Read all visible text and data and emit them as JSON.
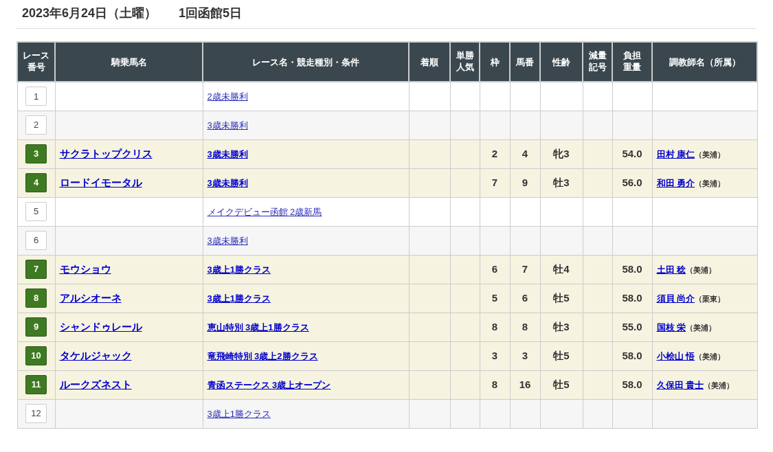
{
  "title": {
    "date": "2023年6月24日（土曜）",
    "meeting": "1回函館5日"
  },
  "table": {
    "columns": [
      "レース番号",
      "騎乗馬名",
      "レース名・競走種別・条件",
      "着順",
      "単勝人気",
      "枠",
      "馬番",
      "性齢",
      "減量記号",
      "負担重量",
      "調教師名（所属）"
    ],
    "rows": [
      {
        "race": "1",
        "ridden": false,
        "race_name": "2歳未勝利"
      },
      {
        "race": "2",
        "ridden": false,
        "race_name": "3歳未勝利"
      },
      {
        "race": "3",
        "ridden": true,
        "horse": "サクラトップクリス",
        "race_name": "3歳未勝利",
        "frame": "2",
        "number": "4",
        "sex_age": "牝3",
        "weight": "54.0",
        "trainer": "田村 康仁",
        "affiliation": "（美浦）"
      },
      {
        "race": "4",
        "ridden": true,
        "horse": "ロードイモータル",
        "race_name": "3歳未勝利",
        "frame": "7",
        "number": "9",
        "sex_age": "牡3",
        "weight": "56.0",
        "trainer": "和田 勇介",
        "affiliation": "（美浦）"
      },
      {
        "race": "5",
        "ridden": false,
        "race_name": "メイクデビュー函館 2歳新馬"
      },
      {
        "race": "6",
        "ridden": false,
        "race_name": "3歳未勝利"
      },
      {
        "race": "7",
        "ridden": true,
        "horse": "モウショウ",
        "race_name": "3歳上1勝クラス",
        "frame": "6",
        "number": "7",
        "sex_age": "牡4",
        "weight": "58.0",
        "trainer": "土田 稔",
        "affiliation": "（美浦）"
      },
      {
        "race": "8",
        "ridden": true,
        "horse": "アルシオーネ",
        "race_name": "3歳上1勝クラス",
        "frame": "5",
        "number": "6",
        "sex_age": "牡5",
        "weight": "58.0",
        "trainer": "須貝 尚介",
        "affiliation": "（栗東）"
      },
      {
        "race": "9",
        "ridden": true,
        "horse": "シャンドゥレール",
        "race_name": "恵山特別 3歳上1勝クラス",
        "frame": "8",
        "number": "8",
        "sex_age": "牡3",
        "weight": "55.0",
        "trainer": "国枝 栄",
        "affiliation": "（美浦）"
      },
      {
        "race": "10",
        "ridden": true,
        "horse": "タケルジャック",
        "race_name": "竜飛崎特別 3歳上2勝クラス",
        "frame": "3",
        "number": "3",
        "sex_age": "牡5",
        "weight": "58.0",
        "trainer": "小桧山 悟",
        "affiliation": "（美浦）"
      },
      {
        "race": "11",
        "ridden": true,
        "horse": "ルークズネスト",
        "race_name": "青函ステークス 3歳上オープン",
        "frame": "8",
        "number": "16",
        "sex_age": "牡5",
        "weight": "58.0",
        "trainer": "久保田 貴士",
        "affiliation": "（美浦）"
      },
      {
        "race": "12",
        "ridden": false,
        "race_name": "3歳上1勝クラス"
      }
    ]
  }
}
